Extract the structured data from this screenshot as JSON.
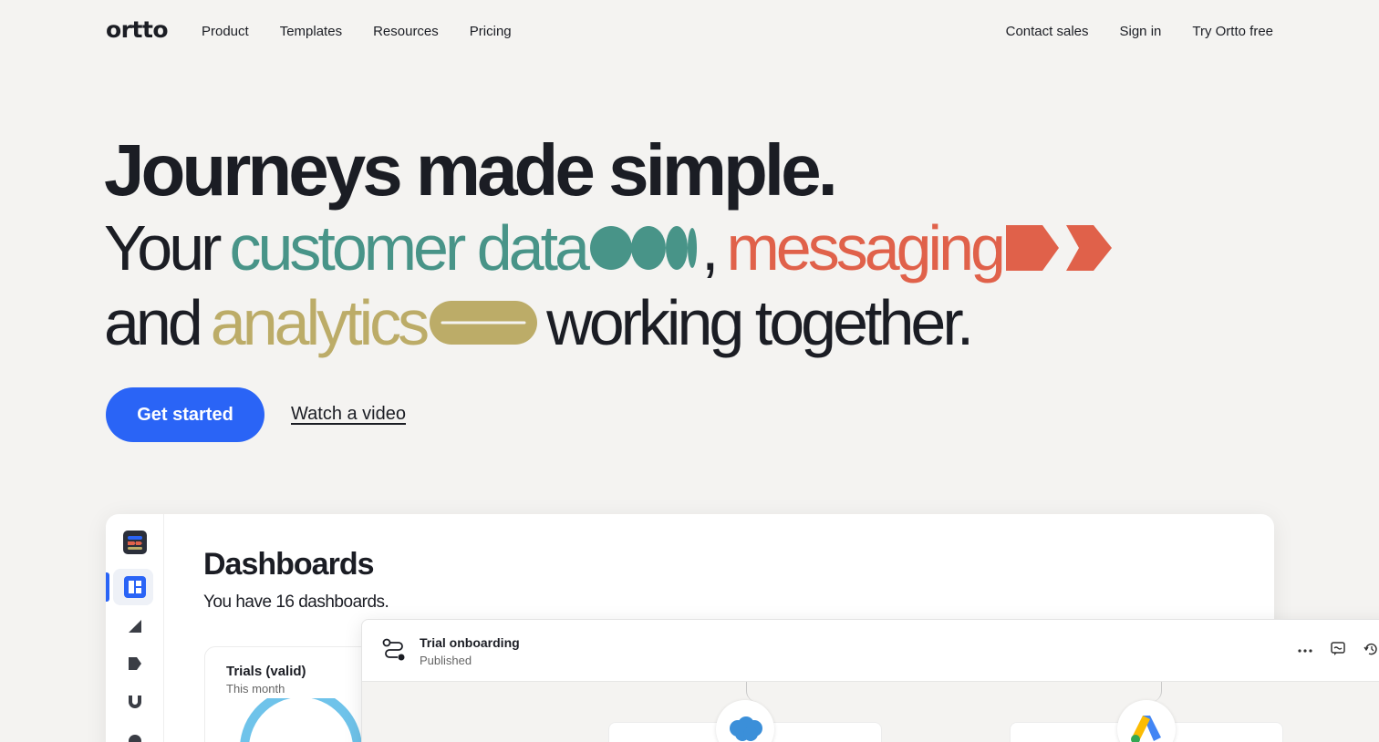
{
  "nav": {
    "logo": "ortto",
    "links": [
      "Product",
      "Templates",
      "Resources",
      "Pricing"
    ],
    "right": [
      "Contact sales",
      "Sign in",
      "Try Ortto free"
    ]
  },
  "hero": {
    "headline": "Journeys made simple.",
    "line1": {
      "your": "Your",
      "customer_data": "customer data",
      "comma": ",",
      "messaging": "messaging"
    },
    "line2": {
      "and": "and",
      "analytics": "analytics",
      "working_together": "working together."
    },
    "cta_label": "Get started",
    "video_label": "Watch a video"
  },
  "colors": {
    "accent": "#2a64f6",
    "teal": "#489488",
    "coral": "#e0614a",
    "olive": "#bcac68",
    "ink": "#1b1d24"
  },
  "app": {
    "dashboard_title": "Dashboards",
    "dashboard_sub": "You have 16 dashboards.",
    "card": {
      "title": "Trials (valid)",
      "subtitle": "This month"
    },
    "sidebar_icons": [
      "app-logo-icon",
      "dashboard-icon",
      "audience-icon",
      "tag-icon",
      "magnet-icon",
      "person-icon"
    ]
  },
  "journey": {
    "title": "Trial onboarding",
    "status": "Published",
    "actions": [
      "more-icon",
      "comment-icon",
      "history-icon"
    ],
    "nodes": [
      "salesforce-icon",
      "google-ads-icon"
    ]
  }
}
